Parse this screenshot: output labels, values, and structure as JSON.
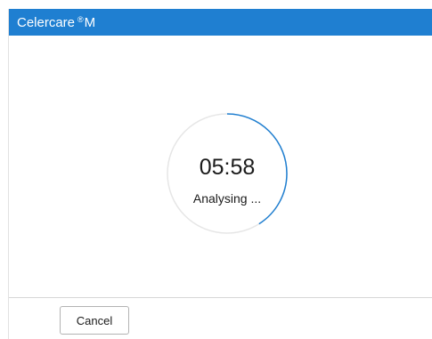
{
  "app": {
    "title": "Celercare",
    "title_mark": "®",
    "title_suffix": "M"
  },
  "timer": {
    "time": "05:58",
    "status": "Analysing ...",
    "progress_fraction": 0.41,
    "track_color": "#e6e6e6",
    "progress_color": "#1f7fd1"
  },
  "footer": {
    "cancel_label": "Cancel"
  },
  "colors": {
    "titlebar": "#1f7fd1",
    "background": "#ffffff"
  }
}
